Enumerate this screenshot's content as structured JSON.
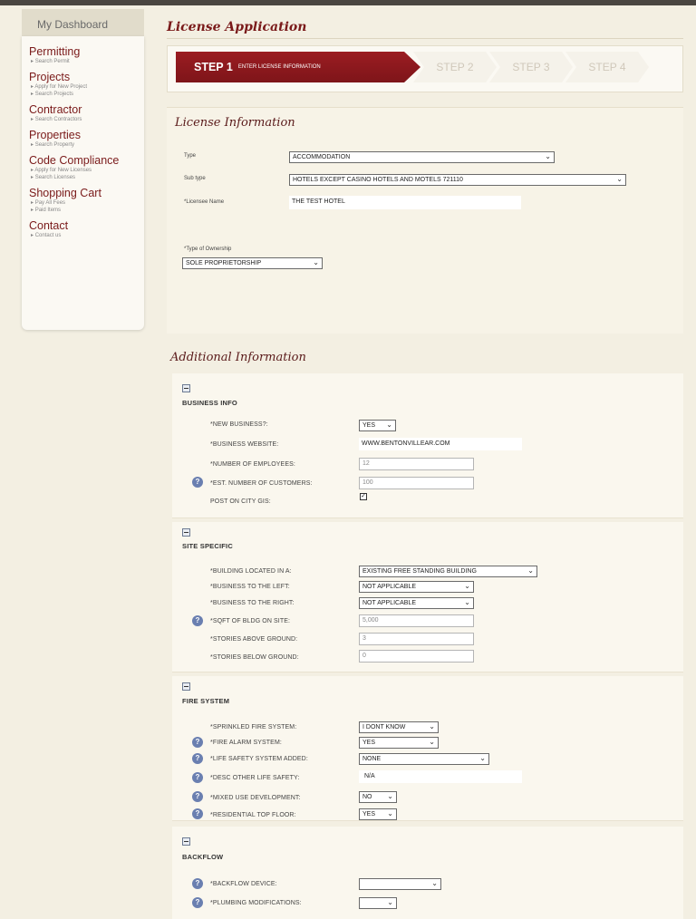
{
  "sidebar": {
    "dashboard": "My Dashboard",
    "sections": [
      {
        "title": "Permitting",
        "links": [
          "Search Permit"
        ]
      },
      {
        "title": "Projects",
        "links": [
          "Apply for New Project",
          "Search Projects"
        ]
      },
      {
        "title": "Contractor",
        "links": [
          "Search Contractors"
        ]
      },
      {
        "title": "Properties",
        "links": [
          "Search Property"
        ]
      },
      {
        "title": "Code Compliance",
        "links": [
          "Apply for New Licenses",
          "Search Licenses"
        ]
      },
      {
        "title": "Shopping Cart",
        "links": [
          "Pay All Fees",
          "Paid Items"
        ]
      },
      {
        "title": "Contact",
        "links": [
          "Contact us"
        ]
      }
    ]
  },
  "page_title": "License Application",
  "steps": {
    "active_num": "STEP 1",
    "active_label": "ENTER LICENSE INFORMATION",
    "others": [
      "STEP 2",
      "STEP 3",
      "STEP 4"
    ]
  },
  "license_info": {
    "title": "License Information",
    "type_label": "Type",
    "type_value": "ACCOMMODATION",
    "subtype_label": "Sub type",
    "subtype_value": "HOTELS EXCEPT CASINO HOTELS AND MOTELS 721110",
    "licensee_label": "*Licensee Name",
    "licensee_value": "THE TEST HOTEL",
    "ownership_label": "*Type of Ownership",
    "ownership_value": "SOLE PROPRIETORSHIP"
  },
  "additional": {
    "title": "Additional Information",
    "business": {
      "title": "BUSINESS INFO",
      "new_label": "*NEW BUSINESS?:",
      "new_value": "YES",
      "website_label": "*BUSINESS WEBSITE:",
      "website_value": "WWW.BENTONVILLEAR.COM",
      "employees_label": "*NUMBER OF EMPLOYEES:",
      "employees_value": "12",
      "customers_label": "*EST. NUMBER OF CUSTOMERS:",
      "customers_value": "100",
      "gis_label": "POST ON CITY GIS:"
    },
    "site": {
      "title": "SITE SPECIFIC",
      "located_label": "*BUILDING LOCATED IN A:",
      "located_value": "EXISTING FREE STANDING BUILDING",
      "left_label": "*BUSINESS TO THE LEFT:",
      "left_value": "NOT APPLICABLE",
      "right_label": "*BUSINESS TO THE RIGHT:",
      "right_value": "NOT APPLICABLE",
      "sqft_label": "*SQFT OF BLDG ON SITE:",
      "sqft_value": "5,000",
      "above_label": "*STORIES ABOVE GROUND:",
      "above_value": "3",
      "below_label": "*STORIES BELOW GROUND:",
      "below_value": "0"
    },
    "fire": {
      "title": "FIRE SYSTEM",
      "sprinkled_label": "*SPRINKLED FIRE SYSTEM:",
      "sprinkled_value": "I DONT KNOW",
      "alarm_label": "*FIRE ALARM SYSTEM:",
      "alarm_value": "YES",
      "safety_label": "*LIFE SAFETY SYSTEM ADDED:",
      "safety_value": "NONE",
      "desc_label": "*DESC OTHER LIFE SAFETY:",
      "desc_value": "N/A",
      "mixed_label": "*MIXED USE DEVELOPMENT:",
      "mixed_value": "NO",
      "residential_label": "*RESIDENTIAL TOP FLOOR:",
      "residential_value": "YES"
    },
    "backflow": {
      "title": "BACKFLOW",
      "device_label": "*BACKFLOW DEVICE:",
      "device_value": "",
      "plumbing_label": "*PLUMBING MODIFICATIONS:",
      "plumbing_value": ""
    }
  }
}
